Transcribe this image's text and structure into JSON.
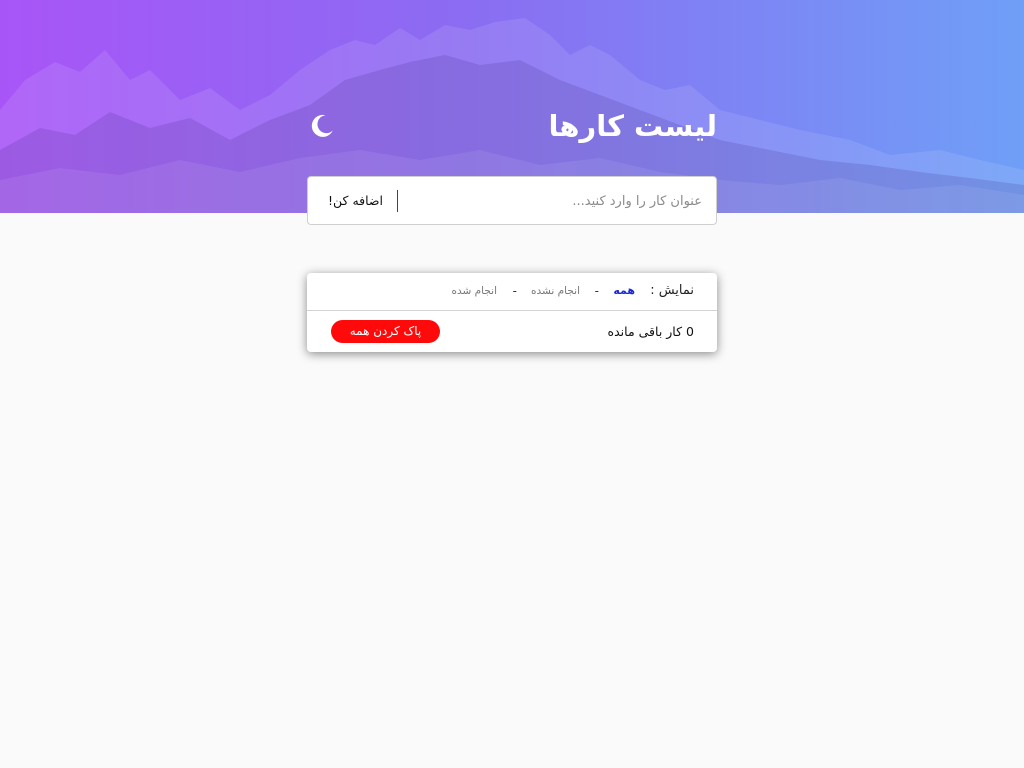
{
  "header": {
    "title": "لیست کارها",
    "theme_toggle_icon": "moon-icon"
  },
  "add_form": {
    "placeholder": "عنوان کار را وارد کنید...",
    "submit_label": "اضافه کن!"
  },
  "filters": {
    "label": "نمایش :",
    "separator": "-",
    "options": [
      {
        "label": "همه",
        "active": true
      },
      {
        "label": "انجام نشده",
        "active": false
      },
      {
        "label": "انجام شده",
        "active": false
      }
    ]
  },
  "footer": {
    "remaining_text": "0 کار باقی مانده",
    "clear_label": "پاک کردن همه"
  },
  "colors": {
    "gradient_start": "#a855f7",
    "gradient_end": "#6f9ff7",
    "active_filter": "#1a28d8",
    "clear_button": "#ff0a0a"
  }
}
